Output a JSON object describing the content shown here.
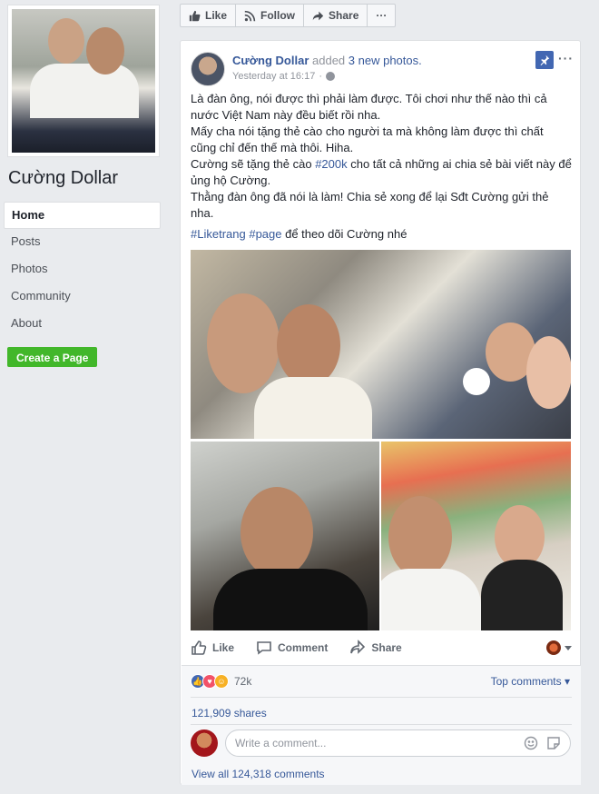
{
  "page": {
    "name": "Cường Dollar"
  },
  "nav": {
    "items": [
      {
        "label": "Home",
        "active": true
      },
      {
        "label": "Posts"
      },
      {
        "label": "Photos"
      },
      {
        "label": "Community"
      },
      {
        "label": "About"
      }
    ],
    "create_page": "Create a Page"
  },
  "topbar": {
    "like": "Like",
    "follow": "Follow",
    "share": "Share",
    "more": "···"
  },
  "post": {
    "author": "Cường Dollar",
    "action_text": "added",
    "photos_link": "3 new photos.",
    "time": "Yesterday at 16:17",
    "separator": "·",
    "more": "···",
    "text_lines": [
      "Là đàn ông, nói được thì phải làm được. Tôi chơi như thế nào thì cả nước Việt Nam này đều biết rồi nha.",
      "Mấy cha nói tặng thẻ cào cho người ta mà không làm được thì chất cũng chỉ đến thế mà thôi. Hiha.",
      "Thằng đàn ông đã nói là làm! Chia sẻ xong để lại Sđt Cường gửi thẻ nha."
    ],
    "line3_before": "Cường sẽ tặng thẻ cào ",
    "line3_hashtag": "#200k",
    "line3_after": " cho tất cả những ai chia sẻ bài viết này để ủng hộ Cường.",
    "tag1": "#Liketrang",
    "tag2": "#page",
    "tags_after": " để theo dõi Cường nhé"
  },
  "actions": {
    "like": "Like",
    "comment": "Comment",
    "share": "Share"
  },
  "feedback": {
    "reaction_count": "72k",
    "top_comments": "Top comments ▾",
    "shares": "121,909 shares",
    "comment_placeholder": "Write a comment...",
    "view_all": "View all 124,318 comments"
  },
  "colors": {
    "link": "#365899",
    "accent": "#4267b2",
    "create_page_green": "#42b72a"
  }
}
